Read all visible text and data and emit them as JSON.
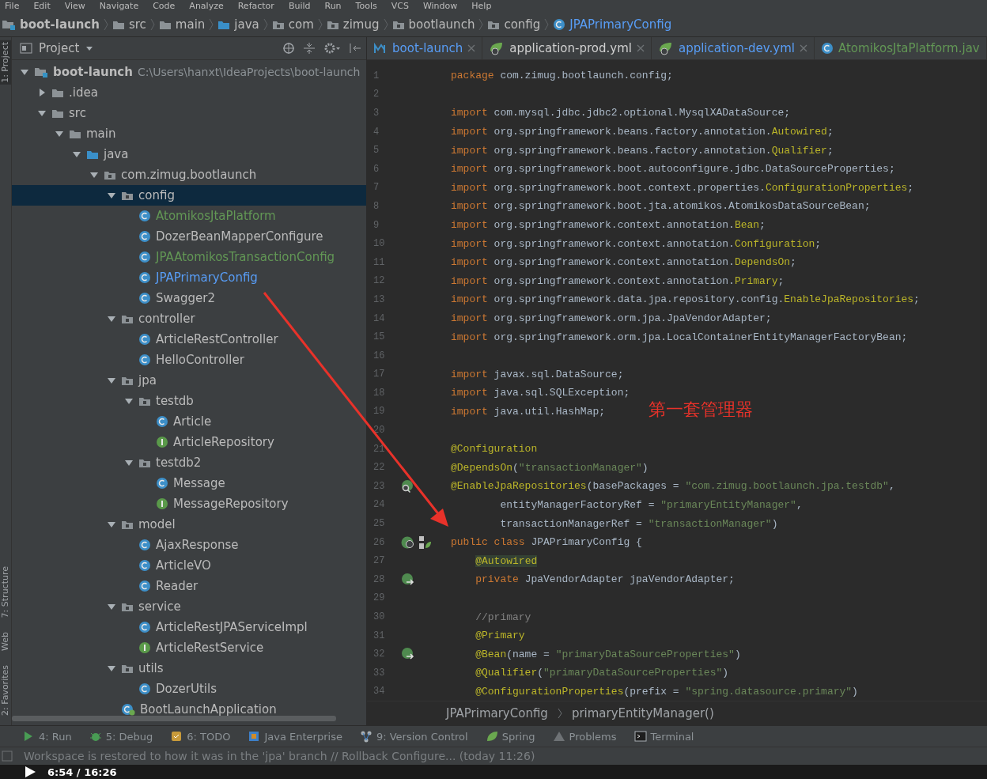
{
  "menu": [
    "File",
    "Edit",
    "View",
    "Navigate",
    "Code",
    "Analyze",
    "Refactor",
    "Build",
    "Run",
    "Tools",
    "VCS",
    "Window",
    "Help"
  ],
  "breadcrumbs": [
    {
      "kind": "module",
      "label": "boot-launch"
    },
    {
      "kind": "folder",
      "label": "src"
    },
    {
      "kind": "folder",
      "label": "main"
    },
    {
      "kind": "source",
      "label": "java"
    },
    {
      "kind": "package",
      "label": "com"
    },
    {
      "kind": "package",
      "label": "zimug"
    },
    {
      "kind": "package",
      "label": "bootlaunch"
    },
    {
      "kind": "package",
      "label": "config"
    },
    {
      "kind": "class",
      "label": "JPAPrimaryConfig"
    }
  ],
  "side_strip": {
    "top": [
      "1: Project"
    ],
    "bottom": [
      "7: Structure",
      "Web",
      "2: Favorites"
    ]
  },
  "project_panel": {
    "title": "Project",
    "tree": [
      {
        "kind": "module",
        "label": "boot-launch",
        "path": "C:\\Users\\hanxt\\IdeaProjects\\boot-launch",
        "expanded": true,
        "selected": false,
        "children": [
          {
            "kind": "folder",
            "label": ".idea",
            "expanded": false,
            "selected": false
          },
          {
            "kind": "folder",
            "label": "src",
            "expanded": true,
            "selected": false,
            "children": [
              {
                "kind": "folder",
                "label": "main",
                "expanded": true,
                "selected": false,
                "children": [
                  {
                    "kind": "source",
                    "label": "java",
                    "expanded": true,
                    "selected": false,
                    "children": [
                      {
                        "kind": "package",
                        "label": "com.zimug.bootlaunch",
                        "expanded": true,
                        "selected": false,
                        "children": [
                          {
                            "kind": "package",
                            "label": "config",
                            "expanded": true,
                            "selected": true,
                            "children": [
                              {
                                "kind": "class",
                                "label": "AtomikosJtaPlatform",
                                "color": "#629755",
                                "selected": false
                              },
                              {
                                "kind": "class",
                                "label": "DozerBeanMapperConfigure",
                                "color": "#bbbbbb",
                                "selected": false
                              },
                              {
                                "kind": "class",
                                "label": "JPAAtomikosTransactionConfig",
                                "color": "#629755",
                                "selected": false
                              },
                              {
                                "kind": "class",
                                "label": "JPAPrimaryConfig",
                                "color": "#589df6",
                                "selected": false
                              },
                              {
                                "kind": "class",
                                "label": "Swagger2",
                                "color": "#bbbbbb",
                                "selected": false
                              }
                            ]
                          },
                          {
                            "kind": "package",
                            "label": "controller",
                            "expanded": true,
                            "selected": false,
                            "children": [
                              {
                                "kind": "class",
                                "label": "ArticleRestController",
                                "color": "#bbbbbb",
                                "selected": false
                              },
                              {
                                "kind": "class",
                                "label": "HelloController",
                                "color": "#bbbbbb",
                                "selected": false
                              }
                            ]
                          },
                          {
                            "kind": "package",
                            "label": "jpa",
                            "expanded": true,
                            "selected": false,
                            "children": [
                              {
                                "kind": "package",
                                "label": "testdb",
                                "expanded": true,
                                "selected": false,
                                "children": [
                                  {
                                    "kind": "class",
                                    "label": "Article",
                                    "color": "#bbbbbb",
                                    "selected": false
                                  },
                                  {
                                    "kind": "interface",
                                    "label": "ArticleRepository",
                                    "color": "#bbbbbb",
                                    "selected": false
                                  }
                                ]
                              },
                              {
                                "kind": "package",
                                "label": "testdb2",
                                "expanded": true,
                                "selected": false,
                                "children": [
                                  {
                                    "kind": "class",
                                    "label": "Message",
                                    "color": "#bbbbbb",
                                    "selected": false
                                  },
                                  {
                                    "kind": "interface",
                                    "label": "MessageRepository",
                                    "color": "#bbbbbb",
                                    "selected": false
                                  }
                                ]
                              }
                            ]
                          },
                          {
                            "kind": "package",
                            "label": "model",
                            "expanded": true,
                            "selected": false,
                            "children": [
                              {
                                "kind": "class",
                                "label": "AjaxResponse",
                                "color": "#bbbbbb",
                                "selected": false
                              },
                              {
                                "kind": "class",
                                "label": "ArticleVO",
                                "color": "#bbbbbb",
                                "selected": false
                              },
                              {
                                "kind": "class",
                                "label": "Reader",
                                "color": "#bbbbbb",
                                "selected": false
                              }
                            ]
                          },
                          {
                            "kind": "package",
                            "label": "service",
                            "expanded": true,
                            "selected": false,
                            "children": [
                              {
                                "kind": "class",
                                "label": "ArticleRestJPAServiceImpl",
                                "color": "#bbbbbb",
                                "selected": false
                              },
                              {
                                "kind": "interface",
                                "label": "ArticleRestService",
                                "color": "#bbbbbb",
                                "selected": false
                              }
                            ]
                          },
                          {
                            "kind": "package",
                            "label": "utils",
                            "expanded": true,
                            "selected": false,
                            "children": [
                              {
                                "kind": "class",
                                "label": "DozerUtils",
                                "color": "#bbbbbb",
                                "selected": false
                              }
                            ]
                          },
                          {
                            "kind": "app",
                            "label": "BootLaunchApplication",
                            "color": "#bbbbbb",
                            "selected": false
                          }
                        ]
                      }
                    ]
                  }
                ]
              }
            ]
          }
        ]
      }
    ]
  },
  "editor": {
    "tabs": [
      {
        "kind": "maven",
        "label": "boot-launch",
        "color": "#589df6"
      },
      {
        "kind": "yml",
        "label": "application-prod.yml",
        "color": "#d0d0d0"
      },
      {
        "kind": "yml",
        "label": "application-dev.yml",
        "color": "#589df6"
      },
      {
        "kind": "class",
        "label": "AtomikosJtaPlatform.jav",
        "color": "#629755"
      }
    ],
    "lines": [
      {
        "number": "1",
        "tokens": [
          {
            "kind": "kw",
            "text": "package"
          },
          {
            "kind": "p",
            "text": " com.zimug.bootlaunch.config;"
          }
        ]
      },
      {
        "number": "2"
      },
      {
        "number": "3",
        "tokens": [
          {
            "kind": "kw",
            "text": "import"
          },
          {
            "kind": "p",
            "text": " com.mysql.jdbc.jdbc2.optional.MysqlXADataSource;"
          }
        ]
      },
      {
        "number": "4",
        "tokens": [
          {
            "kind": "kw",
            "text": "import"
          },
          {
            "kind": "p",
            "text": " org.springframework.beans.factory.annotation."
          },
          {
            "kind": "ann",
            "text": "Autowired"
          },
          {
            "kind": "p",
            "text": ";"
          }
        ]
      },
      {
        "number": "5",
        "tokens": [
          {
            "kind": "kw",
            "text": "import"
          },
          {
            "kind": "p",
            "text": " org.springframework.beans.factory.annotation."
          },
          {
            "kind": "ann",
            "text": "Qualifier"
          },
          {
            "kind": "p",
            "text": ";"
          }
        ]
      },
      {
        "number": "6",
        "tokens": [
          {
            "kind": "kw",
            "text": "import"
          },
          {
            "kind": "p",
            "text": " org.springframework.boot.autoconfigure.jdbc.DataSourceProperties;"
          }
        ]
      },
      {
        "number": "7",
        "tokens": [
          {
            "kind": "kw",
            "text": "import"
          },
          {
            "kind": "p",
            "text": " org.springframework.boot.context.properties."
          },
          {
            "kind": "ann",
            "text": "ConfigurationProperties"
          },
          {
            "kind": "p",
            "text": ";"
          }
        ]
      },
      {
        "number": "8",
        "tokens": [
          {
            "kind": "kw",
            "text": "import"
          },
          {
            "kind": "p",
            "text": " org.springframework.boot.jta.atomikos.AtomikosDataSourceBean;"
          }
        ]
      },
      {
        "number": "9",
        "tokens": [
          {
            "kind": "kw",
            "text": "import"
          },
          {
            "kind": "p",
            "text": " org.springframework.context.annotation."
          },
          {
            "kind": "ann",
            "text": "Bean"
          },
          {
            "kind": "p",
            "text": ";"
          }
        ]
      },
      {
        "number": "10",
        "tokens": [
          {
            "kind": "kw",
            "text": "import"
          },
          {
            "kind": "p",
            "text": " org.springframework.context.annotation."
          },
          {
            "kind": "ann",
            "text": "Configuration"
          },
          {
            "kind": "p",
            "text": ";"
          }
        ]
      },
      {
        "number": "11",
        "tokens": [
          {
            "kind": "kw",
            "text": "import"
          },
          {
            "kind": "p",
            "text": " org.springframework.context.annotation."
          },
          {
            "kind": "ann",
            "text": "DependsOn"
          },
          {
            "kind": "p",
            "text": ";"
          }
        ]
      },
      {
        "number": "12",
        "tokens": [
          {
            "kind": "kw",
            "text": "import"
          },
          {
            "kind": "p",
            "text": " org.springframework.context.annotation."
          },
          {
            "kind": "ann",
            "text": "Primary"
          },
          {
            "kind": "p",
            "text": ";"
          }
        ]
      },
      {
        "number": "13",
        "tokens": [
          {
            "kind": "kw",
            "text": "import"
          },
          {
            "kind": "p",
            "text": " org.springframework.data.jpa.repository.config."
          },
          {
            "kind": "ann",
            "text": "EnableJpaRepositories"
          },
          {
            "kind": "p",
            "text": ";"
          }
        ]
      },
      {
        "number": "14",
        "tokens": [
          {
            "kind": "kw",
            "text": "import"
          },
          {
            "kind": "p",
            "text": " org.springframework.orm.jpa.JpaVendorAdapter;"
          }
        ]
      },
      {
        "number": "15",
        "tokens": [
          {
            "kind": "kw",
            "text": "import"
          },
          {
            "kind": "p",
            "text": " org.springframework.orm.jpa.LocalContainerEntityManagerFactoryBean;"
          }
        ]
      },
      {
        "number": "16"
      },
      {
        "number": "17",
        "tokens": [
          {
            "kind": "kw",
            "text": "import"
          },
          {
            "kind": "p",
            "text": " javax.sql.DataSource;"
          }
        ]
      },
      {
        "number": "18",
        "tokens": [
          {
            "kind": "kw",
            "text": "import"
          },
          {
            "kind": "p",
            "text": " java.sql.SQLException;"
          }
        ]
      },
      {
        "number": "19",
        "tokens": [
          {
            "kind": "kw",
            "text": "import"
          },
          {
            "kind": "p",
            "text": " java.util.HashMap;"
          }
        ]
      },
      {
        "number": "20"
      },
      {
        "number": "21",
        "tokens": [
          {
            "kind": "ann",
            "text": "@Configuration"
          }
        ]
      },
      {
        "number": "22",
        "tokens": [
          {
            "kind": "ann",
            "text": "@DependsOn"
          },
          {
            "kind": "p",
            "text": "("
          },
          {
            "kind": "str",
            "text": "\"transactionManager\""
          },
          {
            "kind": "p",
            "text": ")"
          }
        ]
      },
      {
        "number": "23",
        "gutter": {
          "kind": "bean-search"
        },
        "tokens": [
          {
            "kind": "ann",
            "text": "@EnableJpaRepositories"
          },
          {
            "kind": "p",
            "text": "(basePackages = "
          },
          {
            "kind": "str",
            "text": "\"com.zimug.bootlaunch.jpa.testdb\""
          },
          {
            "kind": "p",
            "text": ","
          }
        ]
      },
      {
        "number": "24",
        "tokens": [
          {
            "kind": "p",
            "text": "        entityManagerFactoryRef = "
          },
          {
            "kind": "str",
            "text": "\"primaryEntityManager\""
          },
          {
            "kind": "p",
            "text": ","
          }
        ]
      },
      {
        "number": "25",
        "tokens": [
          {
            "kind": "p",
            "text": "        transactionManagerRef = "
          },
          {
            "kind": "str",
            "text": "\"transactionManager\""
          },
          {
            "kind": "p",
            "text": ")"
          }
        ]
      },
      {
        "number": "26",
        "gutter": {
          "kind": "bean-class"
        },
        "tokens": [
          {
            "kind": "kw",
            "text": "public class"
          },
          {
            "kind": "p",
            "text": " JPAPrimaryConfig {"
          }
        ]
      },
      {
        "number": "27",
        "tokens": [
          {
            "kind": "annhl",
            "text": "    @Autowired"
          }
        ]
      },
      {
        "number": "28",
        "gutter": {
          "kind": "autowire"
        },
        "tokens": [
          {
            "kind": "kw",
            "text": "    private"
          },
          {
            "kind": "p",
            "text": " JpaVendorAdapter jpaVendorAdapter;"
          }
        ]
      },
      {
        "number": "29"
      },
      {
        "number": "30",
        "tokens": [
          {
            "kind": "cmt",
            "text": "    //primary"
          }
        ]
      },
      {
        "number": "31",
        "tokens": [
          {
            "kind": "ann",
            "text": "    @Primary"
          }
        ]
      },
      {
        "number": "32",
        "gutter": {
          "kind": "autowire"
        },
        "tokens": [
          {
            "kind": "ann",
            "text": "    @Bean"
          },
          {
            "kind": "p",
            "text": "(name = "
          },
          {
            "kind": "str",
            "text": "\"primaryDataSourceProperties\""
          },
          {
            "kind": "p",
            "text": ")"
          }
        ]
      },
      {
        "number": "33",
        "tokens": [
          {
            "kind": "ann",
            "text": "    @Qualifier"
          },
          {
            "kind": "p",
            "text": "("
          },
          {
            "kind": "str",
            "text": "\"primaryDataSourceProperties\""
          },
          {
            "kind": "p",
            "text": ")"
          }
        ]
      },
      {
        "number": "34",
        "tokens": [
          {
            "kind": "ann",
            "text": "    @ConfigurationProperties"
          },
          {
            "kind": "p",
            "text": "(prefix = "
          },
          {
            "kind": "str",
            "text": "\"spring.datasource.primary\""
          },
          {
            "kind": "p",
            "text": ")"
          }
        ]
      }
    ],
    "breadcrumb": [
      "JPAPrimaryConfig",
      "primaryEntityManager()"
    ]
  },
  "annotation": {
    "text": "第一套管理器"
  },
  "tool_buttons": [
    {
      "kind": "run",
      "label": "4: Run"
    },
    {
      "kind": "debug",
      "label": "5: Debug"
    },
    {
      "kind": "todo",
      "label": "6: TODO"
    },
    {
      "kind": "javaee",
      "label": "Java Enterprise"
    },
    {
      "kind": "vcs",
      "label": "9: Version Control"
    },
    {
      "kind": "spring",
      "label": "Spring"
    },
    {
      "kind": "problems",
      "label": "Problems"
    },
    {
      "kind": "terminal",
      "label": "Terminal"
    }
  ],
  "status_bar": "Workspace is restored to how it was in the 'jpa' branch // Rollback Configure... (today 11:26)",
  "video": {
    "time": "6:54 / 16:26"
  }
}
